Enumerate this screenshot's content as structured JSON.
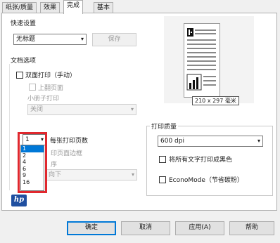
{
  "tabs": [
    {
      "label": "纸张/质量"
    },
    {
      "label": "效果"
    },
    {
      "label": "完成"
    },
    {
      "label": "基本"
    }
  ],
  "quick_settings": {
    "label": "快速设置",
    "selected": "无标题",
    "save_label": "保存"
  },
  "document_options": {
    "label": "文档选项",
    "duplex_label": "双面打印（手动）",
    "flip_up_label": "上翻页面",
    "booklet_label": "小册子打印",
    "booklet_value": "关闭",
    "pages_per_sheet_value": "1",
    "pages_per_sheet_label": "每张打印页数",
    "print_border_label": "印页面边框",
    "order_label": "序",
    "order_value": "向下",
    "pages_per_sheet_options": [
      "1",
      "2",
      "4",
      "6",
      "9",
      "16"
    ]
  },
  "preview": {
    "size_label": "210 x 297 毫米"
  },
  "print_quality": {
    "label": "打印质量",
    "value": "600 dpi",
    "black_text_label": "将所有文字打印成黑色",
    "economode_label": "EconoMode（节省碳粉）"
  },
  "logo_text": "hp",
  "buttons": {
    "ok": "确定",
    "cancel": "取消",
    "apply": "应用(A)",
    "help": "帮助"
  },
  "colors": {
    "highlight": "#e0282e",
    "selection": "#0078d7",
    "hp_blue": "#1f4fa0"
  }
}
